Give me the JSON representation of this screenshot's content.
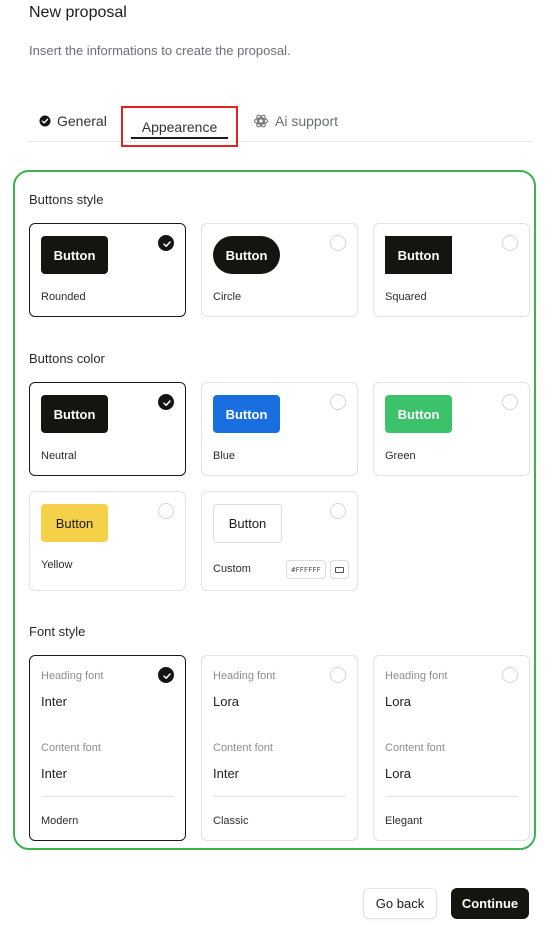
{
  "header": {
    "title": "New proposal",
    "subtitle": "Insert the informations to create the proposal."
  },
  "tabs": [
    {
      "label": "General",
      "icon": "check-circle-icon",
      "active": false
    },
    {
      "label": "Appearence",
      "icon": "",
      "active": true
    },
    {
      "label": "Ai support",
      "icon": "openai-icon",
      "active": false
    }
  ],
  "sections": {
    "buttons_style": {
      "label": "Buttons style",
      "options": [
        {
          "sample": "Button",
          "name": "Rounded",
          "selected": true
        },
        {
          "sample": "Button",
          "name": "Circle",
          "selected": false
        },
        {
          "sample": "Button",
          "name": "Squared",
          "selected": false
        }
      ]
    },
    "buttons_color": {
      "label": "Buttons color",
      "options": [
        {
          "sample": "Button",
          "name": "Neutral",
          "color": "#15150f",
          "selected": true
        },
        {
          "sample": "Button",
          "name": "Blue",
          "color": "#1a6fe0",
          "selected": false
        },
        {
          "sample": "Button",
          "name": "Green",
          "color": "#3cc26a",
          "selected": false
        },
        {
          "sample": "Button",
          "name": "Yellow",
          "color": "#f5d14a",
          "selected": false
        },
        {
          "sample": "Button",
          "name": "Custom",
          "color": "#FFFFFF",
          "hex": "#FFFFFF",
          "selected": false
        }
      ]
    },
    "font_style": {
      "label": "Font style",
      "heading_label": "Heading font",
      "content_label": "Content font",
      "options": [
        {
          "heading": "Inter",
          "content": "Inter",
          "name": "Modern",
          "selected": true
        },
        {
          "heading": "Lora",
          "content": "Inter",
          "name": "Classic",
          "selected": false
        },
        {
          "heading": "Lora",
          "content": "Lora",
          "name": "Elegant",
          "selected": false
        }
      ]
    }
  },
  "footer": {
    "back_label": "Go back",
    "continue_label": "Continue"
  }
}
